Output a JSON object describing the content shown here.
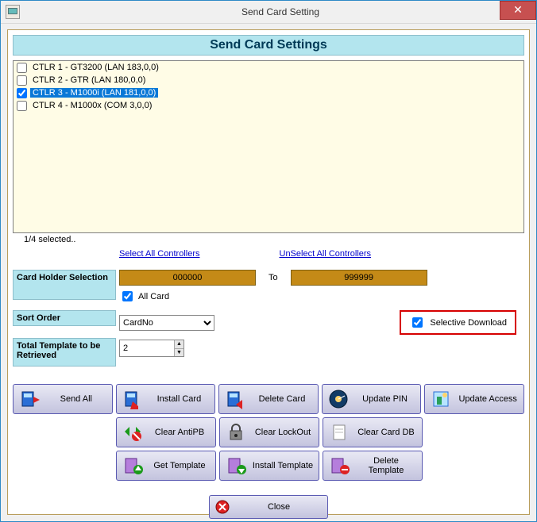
{
  "window": {
    "title": "Send Card Setting",
    "close_glyph": "✕"
  },
  "header": "Send Card Settings",
  "controllers": [
    {
      "label": "CTLR 1 - GT3200 (LAN 183,0,0)",
      "checked": false,
      "selected": false
    },
    {
      "label": "CTLR 2 - GTR (LAN 180,0,0)",
      "checked": false,
      "selected": false
    },
    {
      "label": "CTLR 3 - M1000i (LAN 181,0,0)",
      "checked": true,
      "selected": true
    },
    {
      "label": "CTLR 4 - M1000x (COM 3,0,0)",
      "checked": false,
      "selected": false
    }
  ],
  "selection_status": "1/4 selected..",
  "links": {
    "select_all": "Select All Controllers",
    "unselect_all": "UnSelect All Controllers"
  },
  "cardholder": {
    "label": "Card Holder Selection",
    "from": "000000",
    "to_label": "To",
    "to": "999999",
    "allcard_label": "All Card",
    "allcard_checked": true
  },
  "sort": {
    "label": "Sort Order",
    "value": "CardNo",
    "options": [
      "CardNo"
    ]
  },
  "selective": {
    "label": "Selective Download",
    "checked": true
  },
  "total_template": {
    "label": "Total Template to be Retrieved",
    "value": "2"
  },
  "buttons": {
    "send_all": "Send All",
    "install_card": "Install Card",
    "delete_card": "Delete Card",
    "update_pin": "Update PIN",
    "update_access": "Update Access",
    "clear_antipb": "Clear AntiPB",
    "clear_lockout": "Clear LockOut",
    "clear_card_db": "Clear Card DB",
    "get_template": "Get Template",
    "install_template": "Install Template",
    "delete_template": "Delete Template",
    "close": "Close"
  }
}
